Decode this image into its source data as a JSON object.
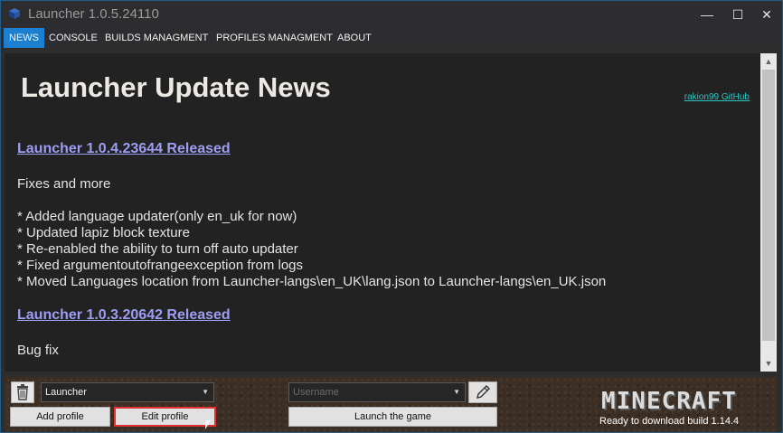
{
  "window": {
    "title": "Launcher 1.0.5.24110",
    "minimize": "—",
    "maximize": "☐",
    "close": "✕"
  },
  "tabs": [
    {
      "label": "NEWS",
      "active": true
    },
    {
      "label": "CONSOLE",
      "active": false
    },
    {
      "label": "BUILDS MANAGMENT",
      "active": false
    },
    {
      "label": "PROFILES MANAGMENT",
      "active": false
    },
    {
      "label": "ABOUT",
      "active": false
    }
  ],
  "news": {
    "title": "Launcher Update News",
    "github_link": "rakion99 GitHub",
    "releases": [
      {
        "title": "Launcher 1.0.4.23644 Released",
        "summary": "Fixes and more",
        "items": [
          "* Added language updater(only en_uk for now)",
          "* Updated lapiz block texture",
          "* Re-enabled the ability to turn off auto updater",
          "* Fixed argumentoutofrangeexception from logs",
          "* Moved Languages location from Launcher-langs\\en_UK\\lang.json to Launcher-langs\\en_UK.json"
        ]
      },
      {
        "title": "Launcher 1.0.3.20642 Released",
        "summary": "Bug fix",
        "items": []
      }
    ]
  },
  "bottom": {
    "profile_select": "Launcher",
    "username_placeholder": "Username",
    "add_profile": "Add profile",
    "edit_profile": "Edit profile",
    "launch": "Launch the game",
    "logo": "MINECRAFT",
    "status": "Ready to download build 1.14.4"
  },
  "colors": {
    "accent": "#1c7fd0",
    "link": "#9d9df3",
    "github_link": "#2ec4c4",
    "highlight_border": "#e03030"
  }
}
